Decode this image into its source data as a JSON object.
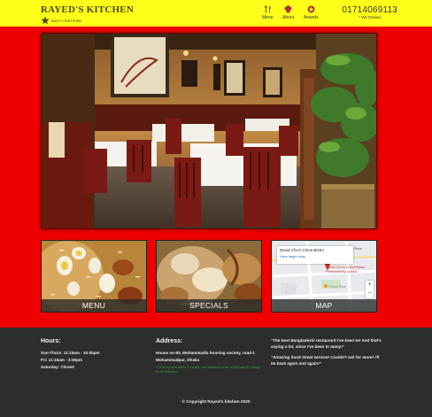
{
  "header": {
    "brand": "RAYED'S KITCHEN",
    "certified": "BDCFI CERTIFIED",
    "nav": [
      {
        "label": "Menu",
        "icon": "fork-knife-icon"
      },
      {
        "label": "About",
        "icon": "chef-hat-icon"
      },
      {
        "label": "Awards",
        "icon": "award-icon"
      }
    ],
    "phone": "01714069113",
    "phone_sub": "* We Deliver"
  },
  "hero": {
    "icon": "restaurant-interior-photo"
  },
  "cards": [
    {
      "label": "MENU"
    },
    {
      "label": "SPECIALS"
    },
    {
      "label": "MAP"
    }
  ],
  "map": {
    "title": "David Chu's China Bistro",
    "link": "View larger map",
    "side": "Place",
    "pin_label": "David Chu's China Bistro Permanently closed",
    "secondary_place": "China Park"
  },
  "footer": {
    "hours": {
      "title": "Hours:",
      "lines": [
        "Sun-Thurs: 11:15am - 10:00pm",
        "Fri: 11:15am - 2:30pm",
        "Saturday: Closed"
      ]
    },
    "address": {
      "title": "Address:",
      "lines": [
        "House no-93, Mohammadia housing society, road-1",
        "Mohammadpur, Dhaka"
      ],
      "note": "* Delivery area within 3-4 miles, with minimum order of $20 plus $3 charge for all deliveries."
    },
    "quotes": [
      "\"The best Bangladeshi restaurant I've been to! And that's saying a lot, since I've been to many!\"",
      "\"Amazing food! Great service! Couldn't ask for more! I'll be back again and again!\""
    ],
    "copyright": "© Copyright Rayed's kitchen 2020"
  },
  "colors": {
    "header_bg": "#ffff1a",
    "page_bg": "#ee0000",
    "footer_bg": "#2d2d2d",
    "note_green": "#3ca23c"
  }
}
